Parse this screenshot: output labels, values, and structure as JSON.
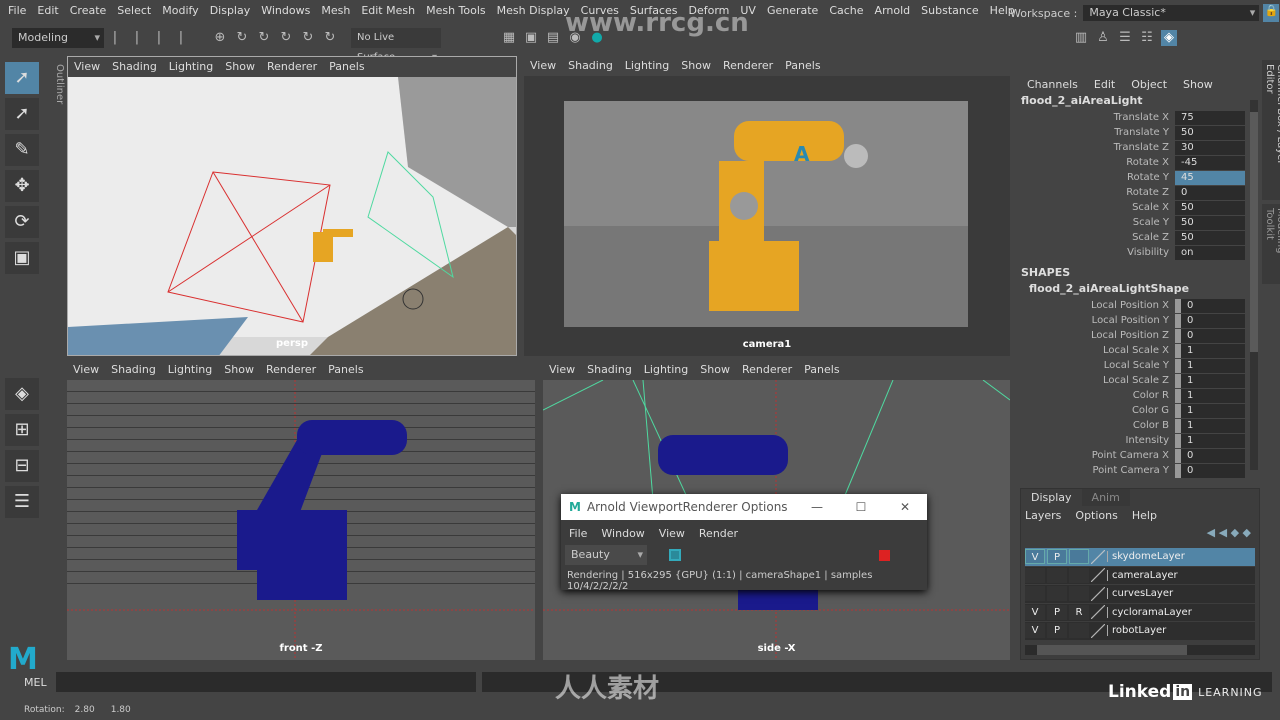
{
  "menubar": [
    "File",
    "Edit",
    "Create",
    "Select",
    "Modify",
    "Display",
    "Windows",
    "Mesh",
    "Edit Mesh",
    "Mesh Tools",
    "Mesh Display",
    "Curves",
    "Surfaces",
    "Deform",
    "UV",
    "Generate",
    "Cache",
    "Arnold",
    "Substance",
    "Help"
  ],
  "workspace": {
    "label": "Workspace :",
    "value": "Maya Classic*"
  },
  "statusline": {
    "mode": "Modeling",
    "live_surface": "No Live Surface"
  },
  "outliner_tab": "Outliner",
  "viewport_menu": [
    "View",
    "Shading",
    "Lighting",
    "Show",
    "Renderer",
    "Panels"
  ],
  "viewports": [
    {
      "label": "persp"
    },
    {
      "label": "camera1"
    },
    {
      "label": "front -Z"
    },
    {
      "label": "side -X"
    }
  ],
  "channelbox": {
    "menu": [
      "Channels",
      "Edit",
      "Object",
      "Show"
    ],
    "object": "flood_2_aiAreaLight",
    "channels": [
      {
        "name": "Translate X",
        "value": "75"
      },
      {
        "name": "Translate Y",
        "value": "50"
      },
      {
        "name": "Translate Z",
        "value": "30"
      },
      {
        "name": "Rotate X",
        "value": "-45"
      },
      {
        "name": "Rotate Y",
        "value": "45"
      },
      {
        "name": "Rotate Z",
        "value": "0"
      },
      {
        "name": "Scale X",
        "value": "50"
      },
      {
        "name": "Scale Y",
        "value": "50"
      },
      {
        "name": "Scale Z",
        "value": "50"
      },
      {
        "name": "Visibility",
        "value": "on"
      }
    ],
    "selected_channel": "Rotate Y",
    "shapes_header": "SHAPES",
    "shape": "flood_2_aiAreaLightShape",
    "shape_channels": [
      {
        "name": "Local Position X",
        "value": "0"
      },
      {
        "name": "Local Position Y",
        "value": "0"
      },
      {
        "name": "Local Position Z",
        "value": "0"
      },
      {
        "name": "Local Scale X",
        "value": "1"
      },
      {
        "name": "Local Scale Y",
        "value": "1"
      },
      {
        "name": "Local Scale Z",
        "value": "1"
      },
      {
        "name": "Color R",
        "value": "1"
      },
      {
        "name": "Color G",
        "value": "1"
      },
      {
        "name": "Color B",
        "value": "1"
      },
      {
        "name": "Intensity",
        "value": "1"
      },
      {
        "name": "Point Camera X",
        "value": "0"
      },
      {
        "name": "Point Camera Y",
        "value": "0"
      }
    ]
  },
  "vertical_tabs": [
    "Channel Box / Layer Editor",
    "Modeling Toolkit"
  ],
  "layer_editor": {
    "tabs": [
      "Display",
      "Anim"
    ],
    "menu": [
      "Layers",
      "Options",
      "Help"
    ],
    "layers": [
      {
        "v": "V",
        "p": "P",
        "r": "",
        "name": "skydomeLayer",
        "selected": true
      },
      {
        "v": "",
        "p": "",
        "r": "",
        "name": "cameraLayer"
      },
      {
        "v": "",
        "p": "",
        "r": "",
        "name": "curvesLayer"
      },
      {
        "v": "V",
        "p": "P",
        "r": "R",
        "name": "cycloramaLayer"
      },
      {
        "v": "V",
        "p": "P",
        "r": "",
        "name": "robotLayer"
      }
    ]
  },
  "arnold_dialog": {
    "title": "Arnold ViewportRenderer Options",
    "menu": [
      "File",
      "Window",
      "View",
      "Render"
    ],
    "aov": "Beauty",
    "status": "Rendering | 516x295 {GPU} (1:1) | cameraShape1  | samples 10/4/2/2/2/2"
  },
  "commandline": {
    "label": "MEL"
  },
  "helpline": {
    "label": "Rotation:",
    "values": [
      "2.80",
      "1.80"
    ]
  },
  "watermark": {
    "site": "www.rrcg.cn",
    "brand": "人人素材",
    "linkedin": "Linked",
    "learning": "LEARNING"
  },
  "colors": {
    "accent": "#5285a6",
    "robot": "#e6a523",
    "robot_wire": "#1a1a8c",
    "light_red": "#d93030",
    "light_green": "#4fd9a0"
  }
}
